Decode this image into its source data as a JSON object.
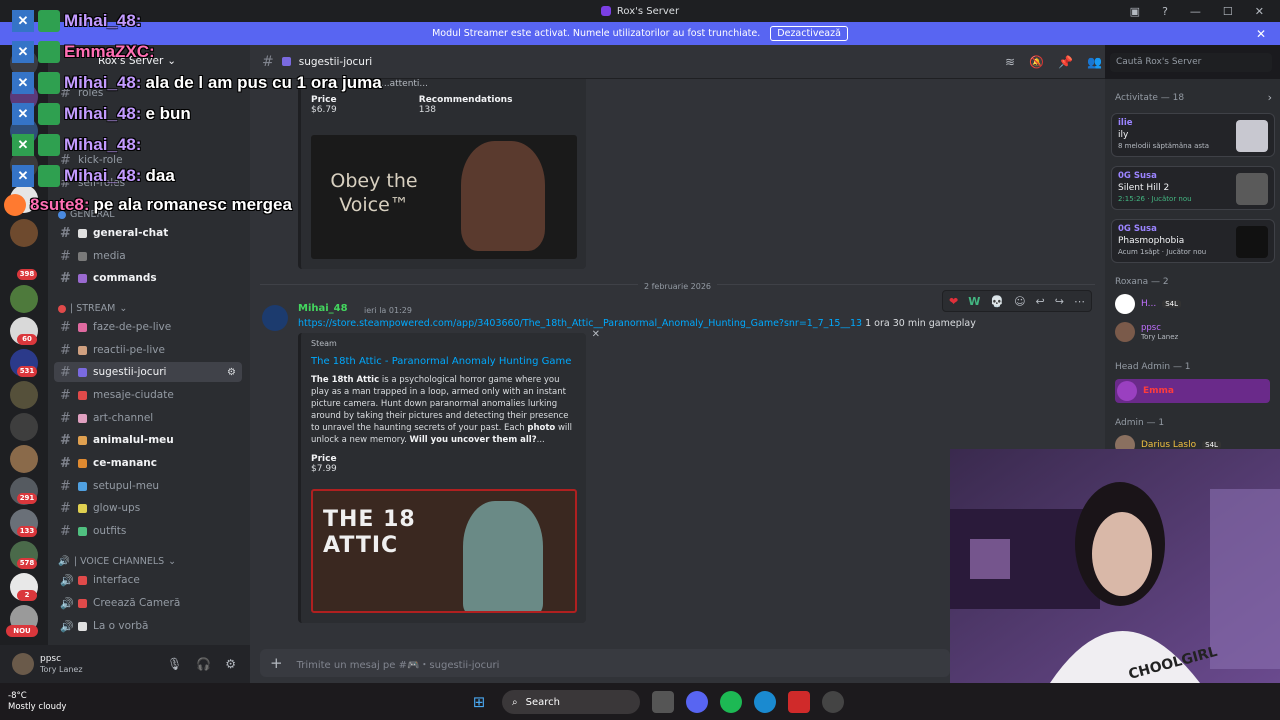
{
  "window": {
    "title": "Rox's Server",
    "controls": [
      "▣",
      "?",
      "—",
      "☐",
      "✕"
    ]
  },
  "banner": {
    "text": "Modul Streamer este activat. Numele utilizatorilor au fost trunchiate.",
    "button": "Dezactivează",
    "close": "✕"
  },
  "rail": {
    "badges": [
      "398",
      "60",
      "531",
      "291",
      "133",
      "578",
      "2"
    ],
    "new_label": "NOU"
  },
  "sidebar": {
    "server_name": "Rox's Server",
    "top_channels": [
      "roles",
      "kick-role",
      "self-roles"
    ],
    "categories": {
      "general": "GENERAL",
      "stream": "| STREAM",
      "voice": "| VOICE CHANNELS"
    },
    "general_channels": [
      "general-chat",
      "media",
      "commands"
    ],
    "stream_channels": [
      "faze-de-pe-live",
      "reactii-pe-live",
      "sugestii-jocuri",
      "mesaje-ciudate",
      "art-channel",
      "animalul-meu",
      "ce-mananc",
      "setupul-meu",
      "glow-ups",
      "outfits"
    ],
    "voice_channels": [
      "interface",
      "Creează Cameră",
      "La o vorbă"
    ]
  },
  "user": {
    "name": "ppsc",
    "status": "Tory Lanez"
  },
  "channel": {
    "name": "sugestii-jocuri",
    "search_placeholder": "Caută Rox's Server"
  },
  "embed1": {
    "partial_text": "...attenti...",
    "price_label": "Price",
    "price": "$6.79",
    "rec_label": "Recommendations",
    "rec": "138",
    "image_title": "Obey the Voice™"
  },
  "date_divider": "2 februarie 2026",
  "message2": {
    "author": "Mihai_48",
    "time": "ieri la 01:29",
    "link": "https://store.steampowered.com/app/3403660/The_18th_Attic__Paranormal_Anomaly_Hunting_Game?snr=1_7_15__13",
    "tail": "1 ora 30 min gameplay",
    "reactions": [
      "❤",
      "W",
      "💀"
    ]
  },
  "embed2": {
    "provider": "Steam",
    "title": "The 18th Attic - Paranormal Anomaly Hunting Game",
    "desc_b1": "The 18th Attic",
    "desc_1": " is a psychological horror game where you play as a man trapped in a loop, armed only with an instant picture camera. Hunt down paranormal anomalies lurking around by taking their pictures and detecting their presence to unravel the haunting secrets of your past. Each ",
    "desc_b2": "photo",
    "desc_2": " will unlock a new memory. ",
    "desc_b3": "Will you uncover them all?",
    "desc_3": "...",
    "price_label": "Price",
    "price": "$7.99",
    "image_title": "THE 18 ATTIC",
    "close": "✕"
  },
  "composer": {
    "placeholder": "Trimite un mesaj pe #🎮・sugestii-jocuri"
  },
  "members": {
    "activity_header": "Activitate — 18",
    "activities": [
      {
        "name": "ilie",
        "game": "ily",
        "detail": "8 melodii săptămâna asta"
      },
      {
        "name": "0G Susa",
        "game": "Silent Hill 2",
        "detail": "2:15:26 · Jucător nou"
      },
      {
        "name": "0G Susa",
        "game": "Phasmophobia",
        "detail": "Acum 1săpt · Jucător nou"
      }
    ],
    "roxana_header": "Roxana — 2",
    "roxana_members": [
      {
        "name": "H...",
        "tag": "S4L"
      },
      {
        "name": "ppsc",
        "status": "Tory Lanez"
      }
    ],
    "head_admin_header": "Head Admin — 1",
    "head_admin": "Emma",
    "admin_header": "Admin — 1",
    "admin": "Darius Laslo",
    "admin_tag": "S4L"
  },
  "overlay": [
    {
      "name": "Mihai_48:",
      "text": ""
    },
    {
      "name": "EmmaZXC:",
      "text": ""
    },
    {
      "name": "Mihai_48:",
      "text": "ala de l am pus cu 1 ora juma"
    },
    {
      "name": "Mihai_48:",
      "text": "e bun"
    },
    {
      "name": "Mihai_48:",
      "text": ""
    },
    {
      "name": "Mihai_48:",
      "text": "daa"
    },
    {
      "name": "8sute8:",
      "text": "pe ala romanesc mergea"
    }
  ],
  "taskbar": {
    "temp": "-8°C",
    "weather": "Mostly cloudy",
    "search": "Search"
  }
}
